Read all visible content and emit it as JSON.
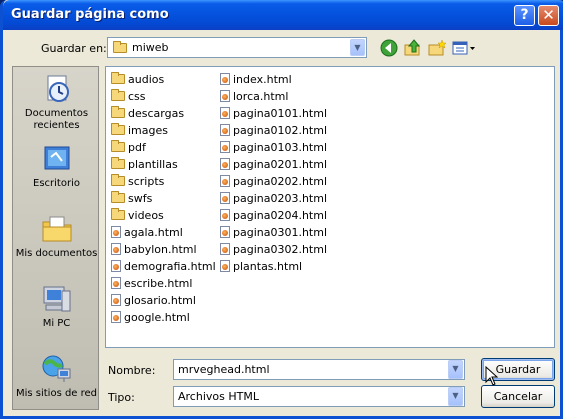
{
  "window": {
    "title": "Guardar página como"
  },
  "title_buttons": {
    "help": "?",
    "close": "✕"
  },
  "save_in": {
    "label": "Guardar en:",
    "value": "miweb"
  },
  "toolbar": {
    "icons": [
      "back-icon",
      "up-folder-icon",
      "new-folder-icon",
      "views-menu-icon"
    ]
  },
  "places": [
    {
      "label": "Documentos recientes",
      "icon": "recent-documents-icon"
    },
    {
      "label": "Escritorio",
      "icon": "desktop-icon"
    },
    {
      "label": "Mis documentos",
      "icon": "my-documents-icon"
    },
    {
      "label": "Mi PC",
      "icon": "my-computer-icon"
    },
    {
      "label": "Mis sitios de red",
      "icon": "network-places-icon"
    }
  ],
  "files": {
    "column1": [
      {
        "name": "audios",
        "type": "folder"
      },
      {
        "name": "css",
        "type": "folder"
      },
      {
        "name": "descargas",
        "type": "folder"
      },
      {
        "name": "images",
        "type": "folder"
      },
      {
        "name": "pdf",
        "type": "folder"
      },
      {
        "name": "plantillas",
        "type": "folder"
      },
      {
        "name": "scripts",
        "type": "folder"
      },
      {
        "name": "swfs",
        "type": "folder"
      },
      {
        "name": "videos",
        "type": "folder"
      },
      {
        "name": "agala.html",
        "type": "html"
      },
      {
        "name": "babylon.html",
        "type": "html"
      },
      {
        "name": "demografia.html",
        "type": "html"
      },
      {
        "name": "escribe.html",
        "type": "html"
      },
      {
        "name": "glosario.html",
        "type": "html"
      },
      {
        "name": "google.html",
        "type": "html"
      }
    ],
    "column2": [
      {
        "name": "index.html",
        "type": "html"
      },
      {
        "name": "lorca.html",
        "type": "html"
      },
      {
        "name": "pagina0101.html",
        "type": "html"
      },
      {
        "name": "pagina0102.html",
        "type": "html"
      },
      {
        "name": "pagina0103.html",
        "type": "html"
      },
      {
        "name": "pagina0201.html",
        "type": "html"
      },
      {
        "name": "pagina0202.html",
        "type": "html"
      },
      {
        "name": "pagina0203.html",
        "type": "html"
      },
      {
        "name": "pagina0204.html",
        "type": "html"
      },
      {
        "name": "pagina0301.html",
        "type": "html"
      },
      {
        "name": "pagina0302.html",
        "type": "html"
      },
      {
        "name": "plantas.html",
        "type": "html"
      }
    ]
  },
  "filename": {
    "label": "Nombre:",
    "value": "mrveghead.html"
  },
  "filetype": {
    "label": "Tipo:",
    "value": "Archivos HTML"
  },
  "buttons": {
    "save": "Guardar",
    "cancel": "Cancelar"
  }
}
